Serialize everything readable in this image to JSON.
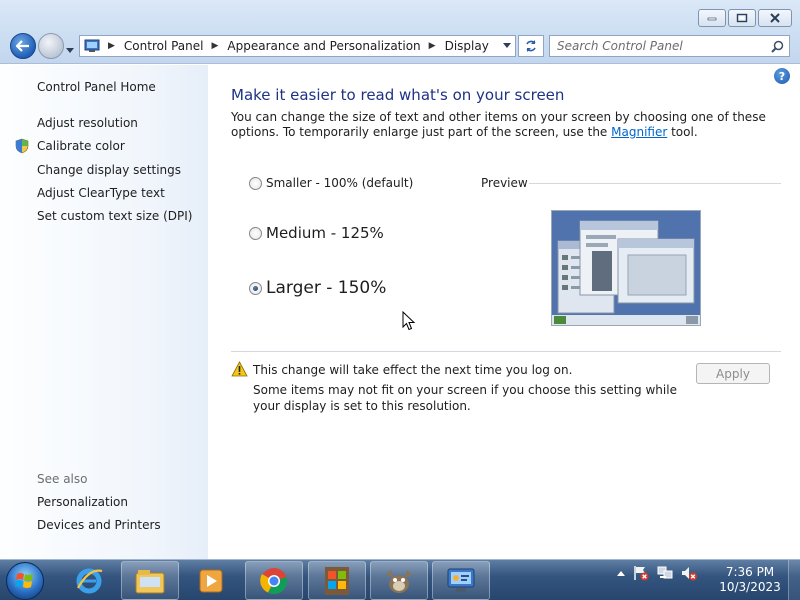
{
  "address_bar": {
    "crumbs": [
      "Control Panel",
      "Appearance and Personalization",
      "Display"
    ]
  },
  "search": {
    "placeholder": "Search Control Panel"
  },
  "sidebar": {
    "home": "Control Panel Home",
    "links": [
      "Adjust resolution",
      "Calibrate color",
      "Change display settings",
      "Adjust ClearType text",
      "Set custom text size (DPI)"
    ],
    "see_also_label": "See also",
    "see_also_links": [
      "Personalization",
      "Devices and Printers"
    ]
  },
  "main": {
    "title": "Make it easier to read what's on your screen",
    "description_before": "You can change the size of text and other items on your screen by choosing one of these options. To temporarily enlarge just part of the screen, use the ",
    "description_link": "Magnifier",
    "description_after": " tool.",
    "options": [
      {
        "label": "Smaller - 100% (default)",
        "checked": false
      },
      {
        "label": "Medium - 125%",
        "checked": false
      },
      {
        "label": "Larger - 150%",
        "checked": true
      }
    ],
    "preview_label": "Preview",
    "warning_title": "This change will take effect the next time you log on.",
    "warning_detail": "Some items may not fit on your screen if you choose this setting while your display is set to this resolution.",
    "apply_label": "Apply"
  },
  "taskbar": {
    "time": "7:36 PM",
    "date": "10/3/2023",
    "apps": [
      "internet-explorer",
      "windows-explorer",
      "media-player",
      "chrome",
      "windows-installer",
      "gimp",
      "control-panel"
    ]
  },
  "colors": {
    "title_blue": "#1e3287",
    "link_blue": "#0066cc",
    "taskbar": "#34557f"
  }
}
